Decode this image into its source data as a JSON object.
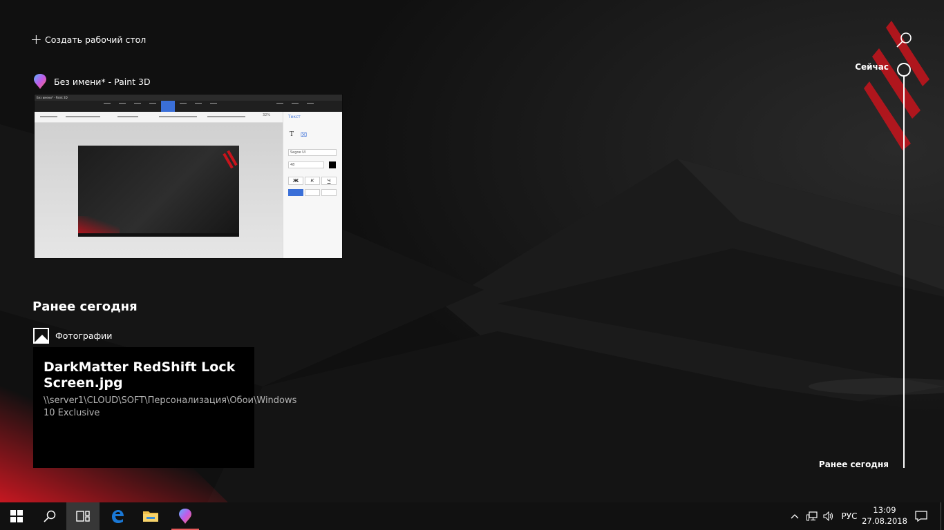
{
  "topbar": {
    "create_desktop_label": "Создать рабочий стол"
  },
  "activity_now": {
    "app_title": "Без имени* - Paint 3D",
    "app_icon": "paint-3d-icon",
    "thumbnail": {
      "window_title": "Без имени* - Paint 3D",
      "side_panel_title": "Текст",
      "font_name": "Segoe UI",
      "font_size": "48",
      "bold_label": "Ж",
      "italic_label": "К",
      "underline_label": "Ч",
      "zoom": "32%"
    }
  },
  "earlier": {
    "section_title": "Ранее сегодня",
    "app_name": "Фотографии",
    "app_icon": "photos-icon",
    "card": {
      "title": "DarkMatter RedShift Lock Screen.jpg",
      "path": "\\\\server1\\CLOUD\\SOFT\\Персонализация\\Обои\\Windows 10 Exclusive"
    }
  },
  "timeline": {
    "now_label": "Сейчас",
    "earlier_label": "Ранее сегодня"
  },
  "taskbar": {
    "pinned": [
      {
        "name": "start-icon"
      },
      {
        "name": "search-icon"
      },
      {
        "name": "task-view-icon"
      },
      {
        "name": "edge-icon"
      },
      {
        "name": "file-explorer-icon"
      },
      {
        "name": "paint-3d-icon"
      }
    ],
    "language": "РУС",
    "time": "13:09",
    "date": "27.08.2018"
  },
  "colors": {
    "accent_red": "#c8141c",
    "edge_blue": "#1a78d6",
    "folder_yellow": "#f0c04a"
  }
}
